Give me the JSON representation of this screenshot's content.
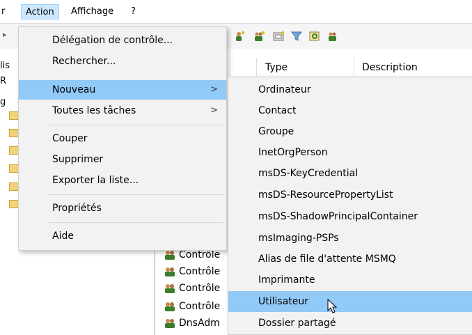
{
  "menubar": {
    "items": [
      {
        "label": "r"
      },
      {
        "label": "Action"
      },
      {
        "label": "Affichage"
      },
      {
        "label": "?"
      }
    ]
  },
  "left_pane": {
    "fragments": [
      "lis",
      "R",
      "g"
    ]
  },
  "list": {
    "columns": [
      "Type",
      "Description"
    ],
    "rows": [
      "Contrôle",
      "Contrôle",
      "Contrôle",
      "Contrôle",
      "DnsAdm"
    ]
  },
  "action_menu": {
    "items": [
      {
        "label": "Délégation de contrôle...",
        "submenu": false
      },
      {
        "label": "Rechercher...",
        "submenu": false
      },
      {
        "label": "Nouveau",
        "submenu": true,
        "highlighted": true
      },
      {
        "label": "Toutes les tâches",
        "submenu": true
      },
      {
        "label": "Couper",
        "submenu": false
      },
      {
        "label": "Supprimer",
        "submenu": false
      },
      {
        "label": "Exporter la liste...",
        "submenu": false
      },
      {
        "label": "Propriétés",
        "submenu": false
      },
      {
        "label": "Aide",
        "submenu": false
      }
    ],
    "submenu_arrow": ">"
  },
  "nouveau_submenu": {
    "items": [
      {
        "label": "Ordinateur"
      },
      {
        "label": "Contact"
      },
      {
        "label": "Groupe"
      },
      {
        "label": "InetOrgPerson"
      },
      {
        "label": "msDS-KeyCredential"
      },
      {
        "label": "msDS-ResourcePropertyList"
      },
      {
        "label": "msDS-ShadowPrincipalContainer"
      },
      {
        "label": "msImaging-PSPs"
      },
      {
        "label": "Alias de file d'attente MSMQ"
      },
      {
        "label": "Imprimante"
      },
      {
        "label": "Utilisateur",
        "highlighted": true
      },
      {
        "label": "Dossier partagé"
      }
    ]
  },
  "colors": {
    "highlight": "#91c9f7",
    "menu_bg": "#f2f2f2",
    "menubar_active": "#cce8ff"
  }
}
